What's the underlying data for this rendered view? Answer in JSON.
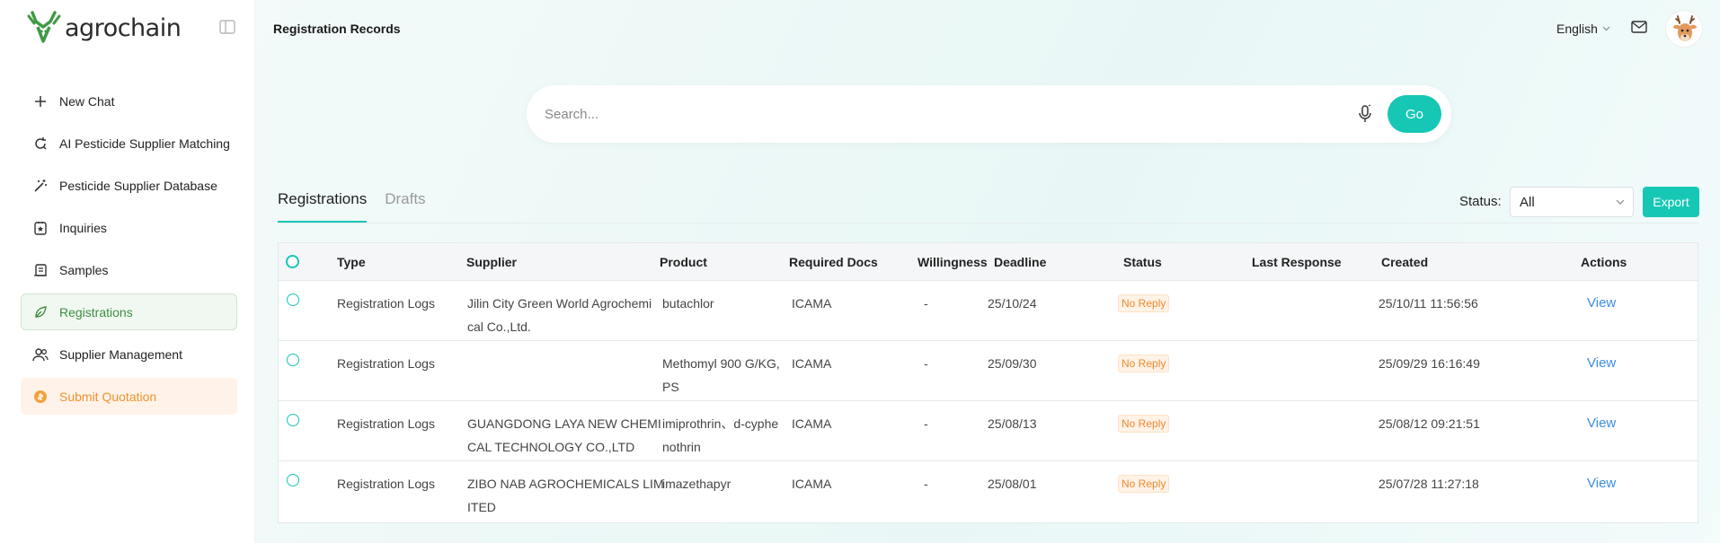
{
  "brand": {
    "name": "agrochain",
    "accent": "#17c7b5",
    "logo_green": "#3f9a45"
  },
  "sidebar": {
    "items": [
      {
        "label": "New Chat",
        "icon": "plus-icon"
      },
      {
        "label": "AI Pesticide Supplier Matching",
        "icon": "refresh-search-icon"
      },
      {
        "label": "Pesticide Supplier Database",
        "icon": "magic-wand-icon"
      },
      {
        "label": "Inquiries",
        "icon": "inquiry-icon"
      },
      {
        "label": "Samples",
        "icon": "samples-icon"
      },
      {
        "label": "Registrations",
        "icon": "leaf-icon"
      },
      {
        "label": "Supplier Management",
        "icon": "users-icon"
      },
      {
        "label": "Submit Quotation",
        "icon": "coin-icon"
      }
    ]
  },
  "header": {
    "title": "Registration Records",
    "language": "English"
  },
  "search": {
    "placeholder": "Search...",
    "go_label": "Go"
  },
  "tabs": [
    {
      "label": "Registrations"
    },
    {
      "label": "Drafts"
    }
  ],
  "filters": {
    "status_label": "Status:",
    "status_value": "All",
    "export_label": "Export"
  },
  "table": {
    "columns": [
      "Type",
      "Supplier",
      "Product",
      "Required Docs",
      "Willingness",
      "Deadline",
      "Status",
      "Last Response",
      "Created",
      "Actions"
    ],
    "rows": [
      {
        "type": "Registration Logs",
        "supplier_l1": "Jilin City Green World Agrochemi",
        "supplier_l2": "cal Co.,Ltd.",
        "product_l1": "butachlor",
        "product_l2": "",
        "docs": "ICAMA",
        "willingness": "-",
        "deadline": "25/10/24",
        "status": "No Reply",
        "last_response": "",
        "created": "25/10/11 11:56:56",
        "action": "View"
      },
      {
        "type": "Registration Logs",
        "supplier_l1": "",
        "supplier_l2": "",
        "product_l1": "Methomyl 900 G/KG,",
        "product_l2": "PS",
        "docs": "ICAMA",
        "willingness": "-",
        "deadline": "25/09/30",
        "status": "No Reply",
        "last_response": "",
        "created": "25/09/29 16:16:49",
        "action": "View"
      },
      {
        "type": "Registration Logs",
        "supplier_l1": "GUANGDONG LAYA NEW CHEMI",
        "supplier_l2": "CAL TECHNOLOGY CO.,LTD",
        "product_l1": "imiprothrin、d-cyphe",
        "product_l2": "nothrin",
        "docs": "ICAMA",
        "willingness": "-",
        "deadline": "25/08/13",
        "status": "No Reply",
        "last_response": "",
        "created": "25/08/12 09:21:51",
        "action": "View"
      },
      {
        "type": "Registration Logs",
        "supplier_l1": "ZIBO NAB AGROCHEMICALS LIM",
        "supplier_l2": "ITED",
        "product_l1": "imazethapyr",
        "product_l2": "",
        "docs": "ICAMA",
        "willingness": "-",
        "deadline": "25/08/01",
        "status": "No Reply",
        "last_response": "",
        "created": "25/07/28 11:27:18",
        "action": "View"
      }
    ]
  }
}
